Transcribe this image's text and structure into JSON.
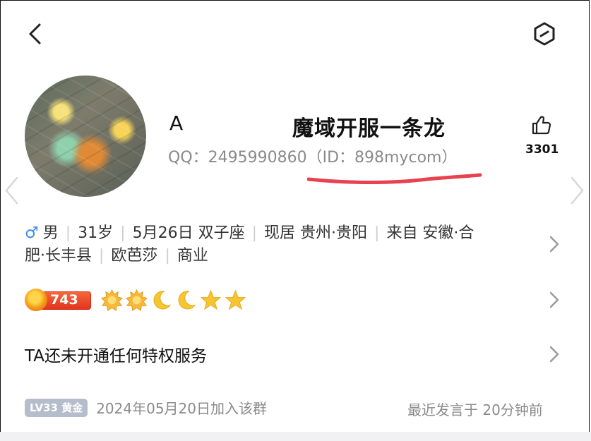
{
  "header": {
    "back_icon": "chevron-left-icon",
    "more_icon": "hexagon-menu-icon"
  },
  "profile": {
    "nickname": "A",
    "group_name": "魔域开服一条龙",
    "qq_line": "QQ：2495990860（ID：898mycom）",
    "like_count": "3301",
    "underline_color": "#e8424f"
  },
  "info": {
    "gender_symbol": "♂",
    "gender": "男",
    "age": "31岁",
    "birthday": "5月26日 双子座",
    "residence": "现居 贵州·贵阳",
    "hometown_a": "来自 安徽·合",
    "hometown_b": "肥·长丰县",
    "company": "欧芭莎",
    "industry": "商业"
  },
  "level": {
    "badge_value": "743",
    "icons": [
      "sun-icon",
      "sun-icon",
      "moon-icon",
      "moon-icon",
      "star-icon",
      "star-icon"
    ]
  },
  "privilege": {
    "text": "TA还未开通任何特权服务"
  },
  "footer": {
    "lv_label": "LV33 黄金",
    "join_text": "2024年05月20日加入该群",
    "last_speak": "最近发言于 20分钟前"
  }
}
